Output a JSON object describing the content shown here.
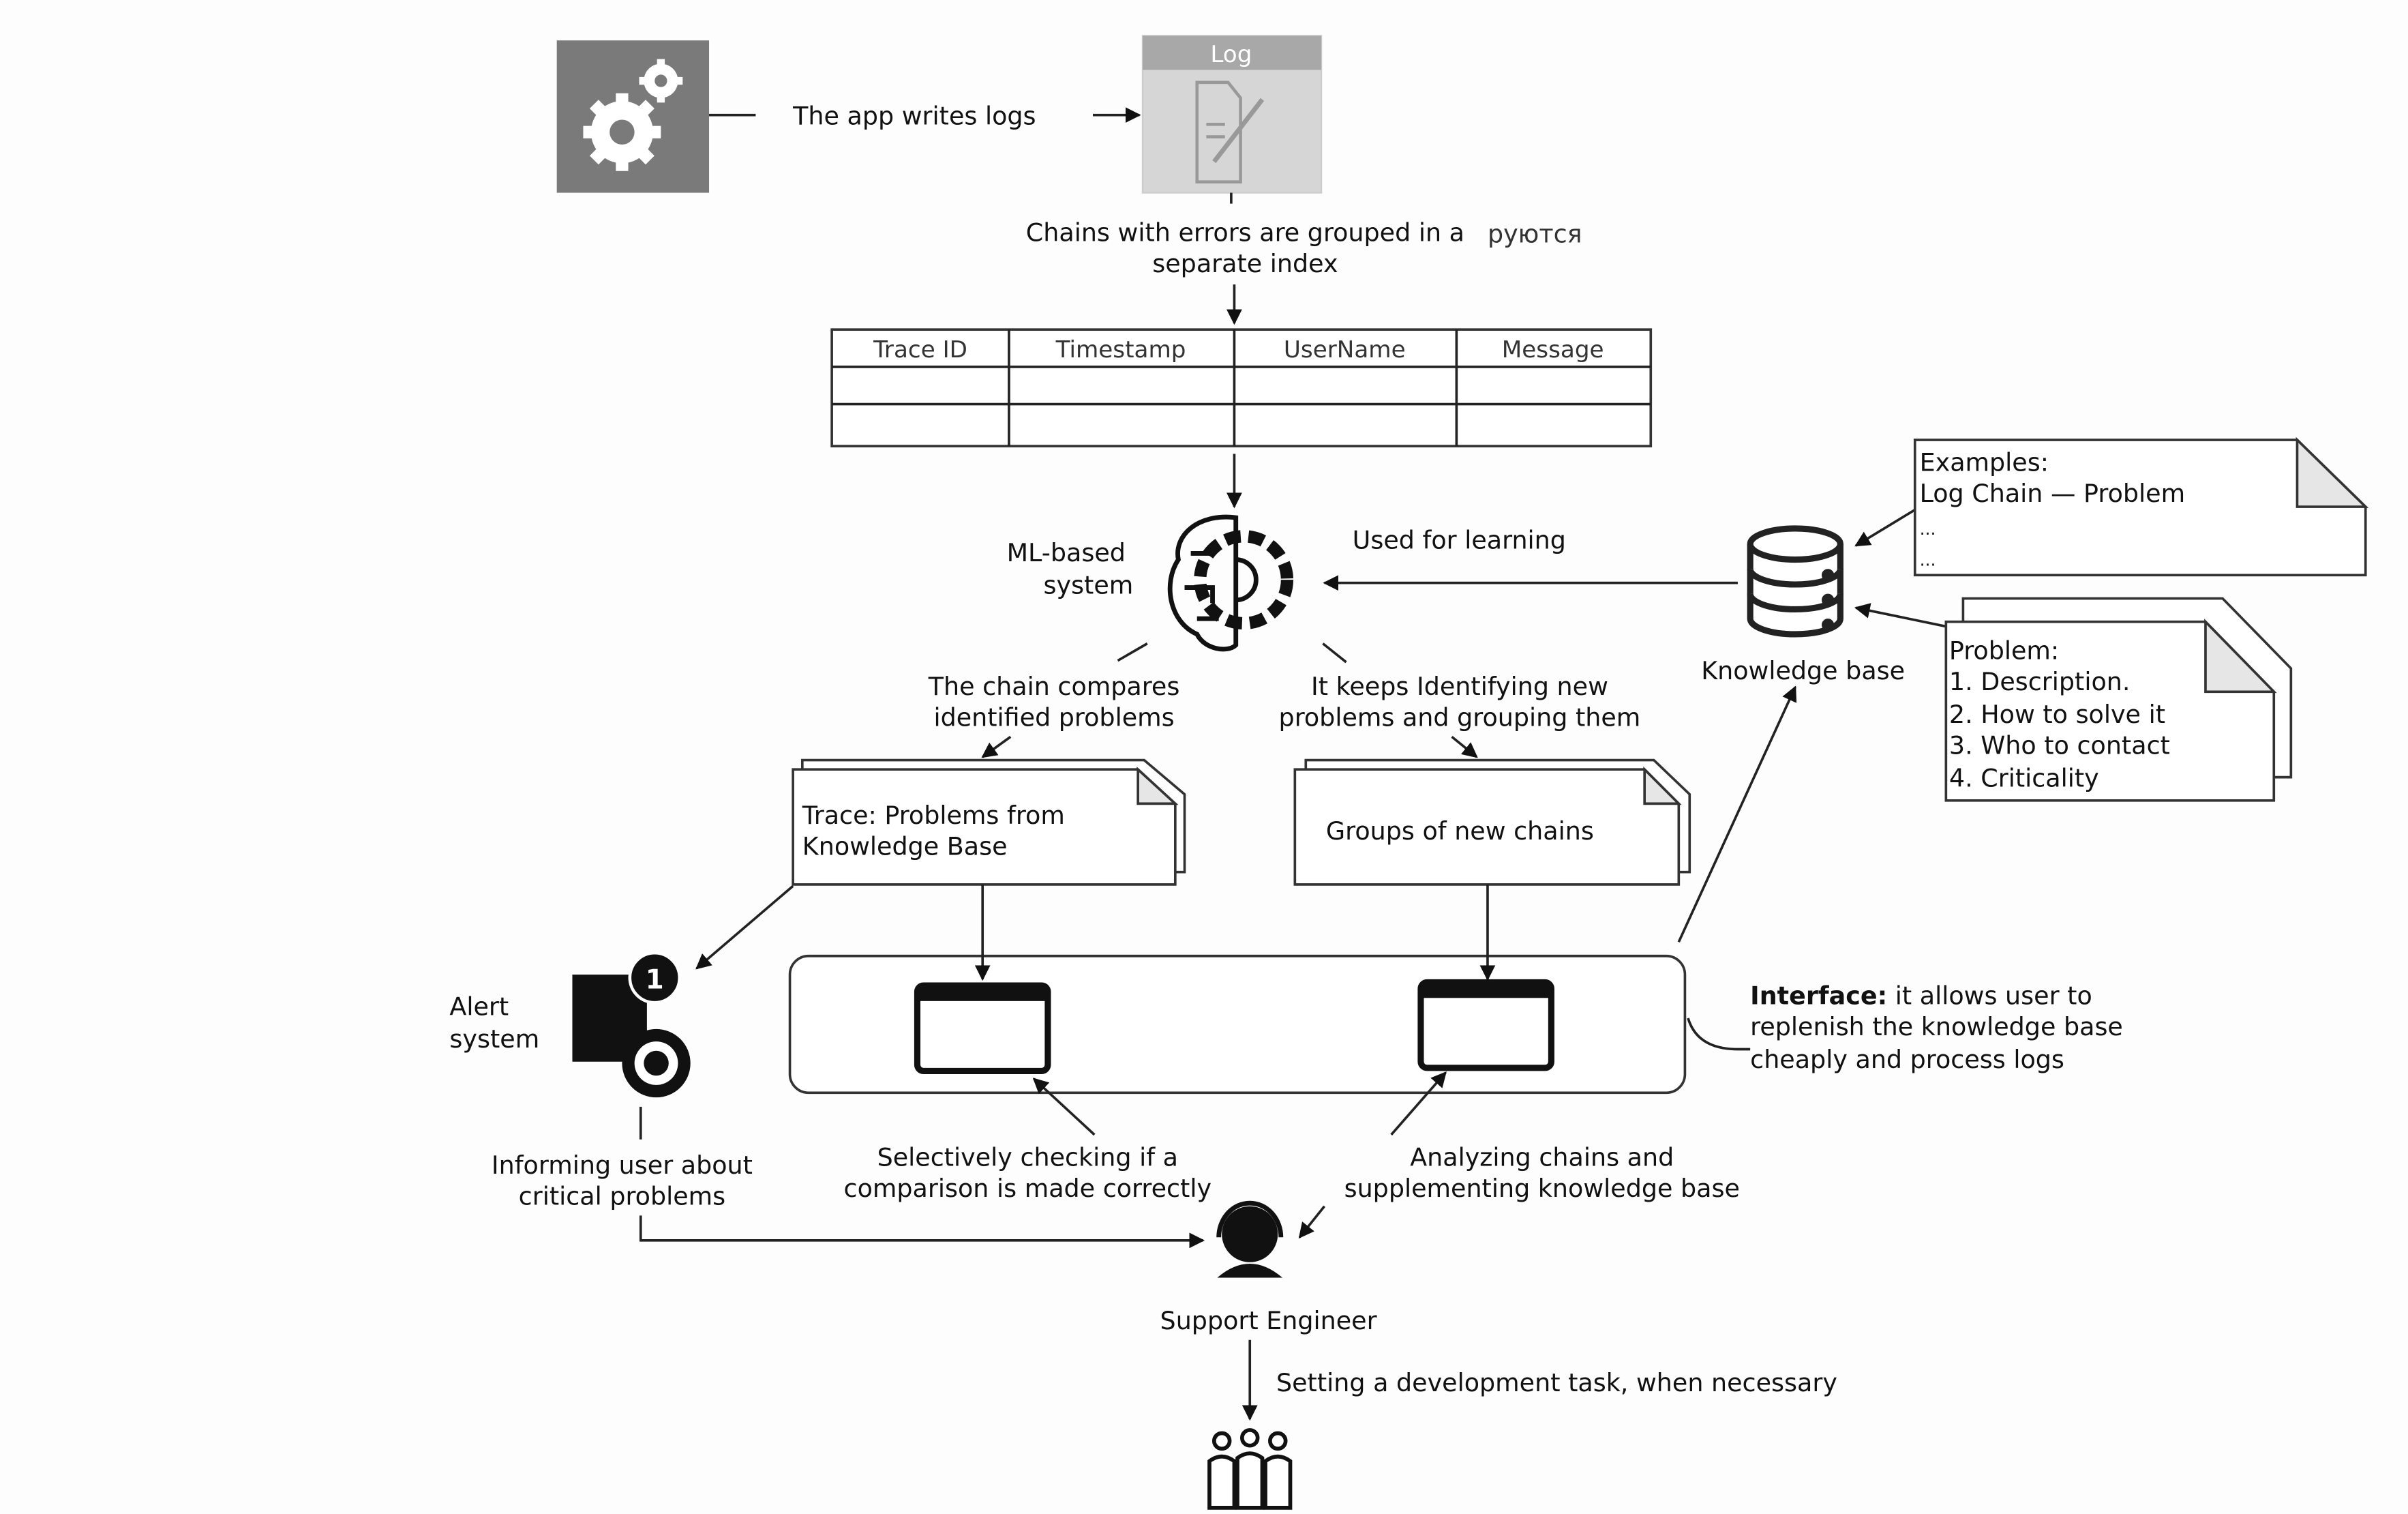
{
  "app_box": {
    "icon": "gears-icon",
    "color": "#7a7a7a"
  },
  "app_writes_logs": "The app writes logs",
  "log_box": {
    "title": "Log",
    "icon": "document-pen-icon",
    "color": "#d3d3d3"
  },
  "chains_grouped": {
    "line1": "Chains with errors are grouped in a",
    "line2": "separate index",
    "overlay": "руются"
  },
  "table": {
    "columns": [
      "Trace ID",
      "Timestamp",
      "UserName",
      "Message"
    ],
    "rows": [
      [
        "",
        "",
        "",
        ""
      ],
      [
        "",
        "",
        "",
        ""
      ]
    ]
  },
  "ml_system": {
    "line1": "ML-based",
    "line2": "system",
    "icon": "brain-gear-icon"
  },
  "used_for_learning": "Used for learning",
  "knowledge_base": {
    "label": "Knowledge base",
    "icon": "database-icon"
  },
  "examples_note": {
    "lines": [
      "Examples:",
      "Log Chain — Problem",
      "...",
      "..."
    ]
  },
  "problem_note": {
    "lines": [
      "Problem:",
      "1. Description.",
      "2. How to solve it",
      "3. Who to contact",
      "4. Criticality"
    ]
  },
  "chain_compares": {
    "line1": "The chain compares",
    "line2": "identified problems"
  },
  "keeps_identifying": {
    "line1": "It keeps Identifying new",
    "line2": "problems and grouping them"
  },
  "trace_doc": {
    "line1": "Trace: Problems from",
    "line2": "Knowledge Base"
  },
  "groups_doc": {
    "line1": "Groups of new chains"
  },
  "alert_system": {
    "line1": "Alert",
    "line2": "system",
    "badge": "1",
    "icon": "alert-gear-icon"
  },
  "interface_note": {
    "bold": "Interface:",
    "line1": " it allows user to",
    "line2": "replenish the knowledge base",
    "line3": "cheaply and process logs"
  },
  "informing_user": {
    "line1": "Informing user about",
    "line2": "critical problems"
  },
  "selectively_checking": {
    "line1": "Selectively checking if a",
    "line2": "comparison is made correctly"
  },
  "analyzing_chains": {
    "line1": "Analyzing chains and",
    "line2": "supplementing knowledge base"
  },
  "support_engineer": {
    "label": "Support Engineer",
    "icon": "headset-user-icon"
  },
  "setting_task": "Setting a development task, when necessary",
  "dev_team": {
    "icon": "team-icon"
  }
}
